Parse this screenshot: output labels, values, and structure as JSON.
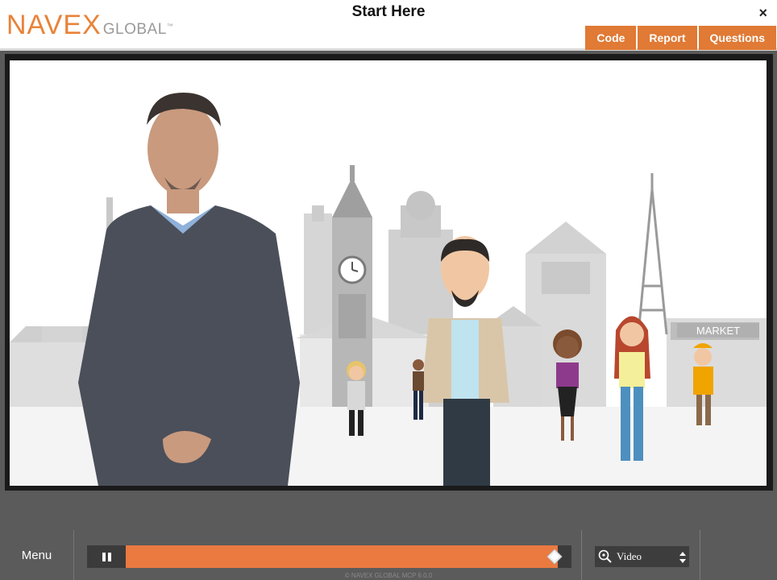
{
  "header": {
    "logo_primary": "NAVEX",
    "logo_secondary": "GLOBAL",
    "logo_tm": "™",
    "title": "Start Here",
    "close_glyph": "×",
    "tabs": [
      {
        "label": "Code"
      },
      {
        "label": "Report"
      },
      {
        "label": "Questions"
      }
    ]
  },
  "controls": {
    "menu_label": "Menu",
    "play_state": "paused",
    "progress_fraction": 0.97,
    "select_value": "Video",
    "copyright": "© NAVEX GLOBAL MCP 6.0.0"
  },
  "video": {
    "sign_text": "MARKET"
  },
  "colors": {
    "accent": "#e07a35",
    "progress": "#ea7a40",
    "logo_navex": "#e8833a",
    "logo_global": "#9a9a9a"
  },
  "icons": {
    "close": "close-icon",
    "play_pause": "pause-icon",
    "select_icon": "magnifier-settings-icon",
    "select_arrows": "updown-arrows-icon",
    "knob": "diamond-knob-icon"
  }
}
